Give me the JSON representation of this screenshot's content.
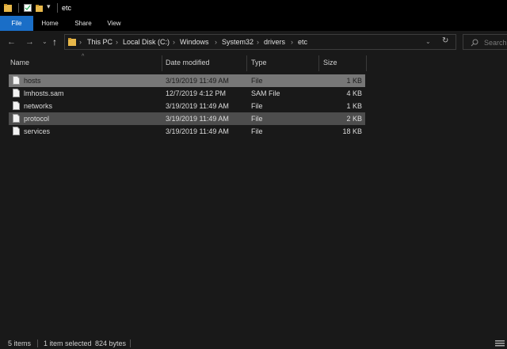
{
  "window": {
    "title": "etc"
  },
  "ribbon": {
    "tabs": [
      "File",
      "Home",
      "Share",
      "View"
    ]
  },
  "nav": {
    "back_icon": "back-arrow-icon",
    "forward_icon": "forward-arrow-icon",
    "recent_icon": "chevron-down-icon",
    "up_icon": "up-arrow-icon"
  },
  "address": {
    "crumbs": [
      "This PC",
      "Local Disk (C:)",
      "Windows",
      "System32",
      "drivers",
      "etc"
    ],
    "dropdown_icon": "chevron-down-icon",
    "refresh_icon": "refresh-icon"
  },
  "search": {
    "placeholder": "Search"
  },
  "columns": {
    "name": "Name",
    "date": "Date modified",
    "type": "Type",
    "size": "Size"
  },
  "files": [
    {
      "name": "hosts",
      "date": "3/19/2019 11:49 AM",
      "type": "File",
      "size": "1 KB",
      "state": "selected"
    },
    {
      "name": "lmhosts.sam",
      "date": "12/7/2019 4:12 PM",
      "type": "SAM File",
      "size": "4 KB",
      "state": ""
    },
    {
      "name": "networks",
      "date": "3/19/2019 11:49 AM",
      "type": "File",
      "size": "1 KB",
      "state": ""
    },
    {
      "name": "protocol",
      "date": "3/19/2019 11:49 AM",
      "type": "File",
      "size": "2 KB",
      "state": "hover"
    },
    {
      "name": "services",
      "date": "3/19/2019 11:49 AM",
      "type": "File",
      "size": "18 KB",
      "state": ""
    }
  ],
  "status": {
    "items": "5 items",
    "selected": "1 item selected",
    "size": "824 bytes"
  },
  "colors": {
    "accent": "#1a6ec7",
    "selected_row": "#777777",
    "hover_row": "#4d4d4d",
    "background": "#191919"
  }
}
